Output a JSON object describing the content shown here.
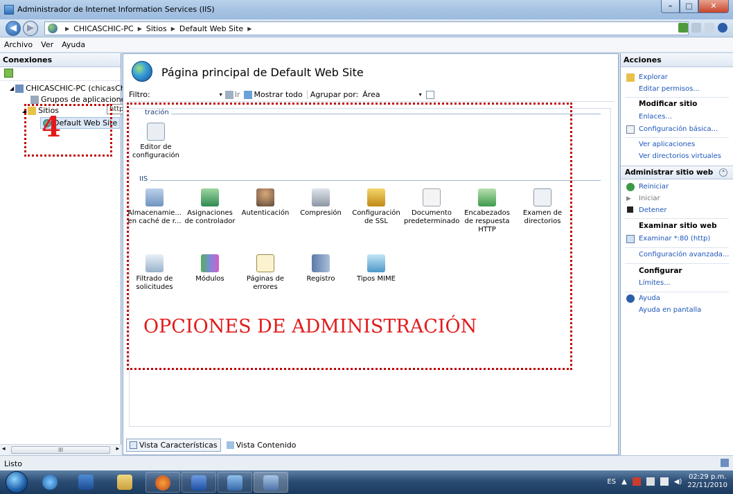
{
  "window": {
    "title": "Administrador de Internet Information Services (IIS)"
  },
  "address": {
    "crumbs": [
      "CHICASCHIC-PC",
      "Sitios",
      "Default Web Site"
    ]
  },
  "menu": {
    "items": [
      "Archivo",
      "Ver",
      "Ayuda"
    ]
  },
  "connections": {
    "title": "Conexiones",
    "tree": {
      "server": "CHICASCHIC-PC (chicasChic",
      "app_pools": "Grupos de aplicaciones",
      "sites": "Sitios",
      "default_site": "Default Web Site"
    },
    "tooltip": "http://localhost/"
  },
  "main": {
    "title": "Página principal de Default Web Site",
    "filter_label": "Filtro:",
    "go_label": "Ir",
    "show_all_label": "Mostrar todo",
    "group_by_label": "Agrupar por:",
    "group_by_value": "Área",
    "group_admin": "tración",
    "group_iis": "IIS",
    "admin_features": [
      "Editor de configuración"
    ],
    "iis_features": [
      "Almacenamie... en caché de r...",
      "Asignaciones de controlador",
      "Autenticación",
      "Compresión",
      "Configuración de SSL",
      "Documento predeterminado",
      "Encabezados de respuesta HTTP",
      "Examen de directorios",
      "Filtrado de solicitudes",
      "Módulos",
      "Páginas de errores",
      "Registro",
      "Tipos MIME"
    ],
    "views": {
      "features": "Vista Características",
      "content": "Vista Contenido"
    }
  },
  "annotations": {
    "number": "4",
    "big_label": "OPCIONES DE ADMINISTRACIÓN"
  },
  "actions": {
    "title": "Acciones",
    "explore": "Explorar",
    "edit_permissions": "Editar permisos...",
    "modify_site": "Modificar sitio",
    "bindings": "Enlaces...",
    "basic_config": "Configuración básica...",
    "view_apps": "Ver aplicaciones",
    "view_vdirs": "Ver directorios virtuales",
    "manage_site": "Administrar sitio web",
    "restart": "Reiniciar",
    "start": "Iniciar",
    "stop": "Detener",
    "browse_site": "Examinar sitio web",
    "browse_80": "Examinar *:80 (http)",
    "advanced_config": "Configuración avanzada...",
    "configure": "Configurar",
    "limits": "Límites...",
    "help": "Ayuda",
    "online_help": "Ayuda en pantalla"
  },
  "status": {
    "text": "Listo"
  },
  "taskbar": {
    "lang": "ES",
    "time": "02:29 p.m.",
    "date": "22/11/2010"
  }
}
